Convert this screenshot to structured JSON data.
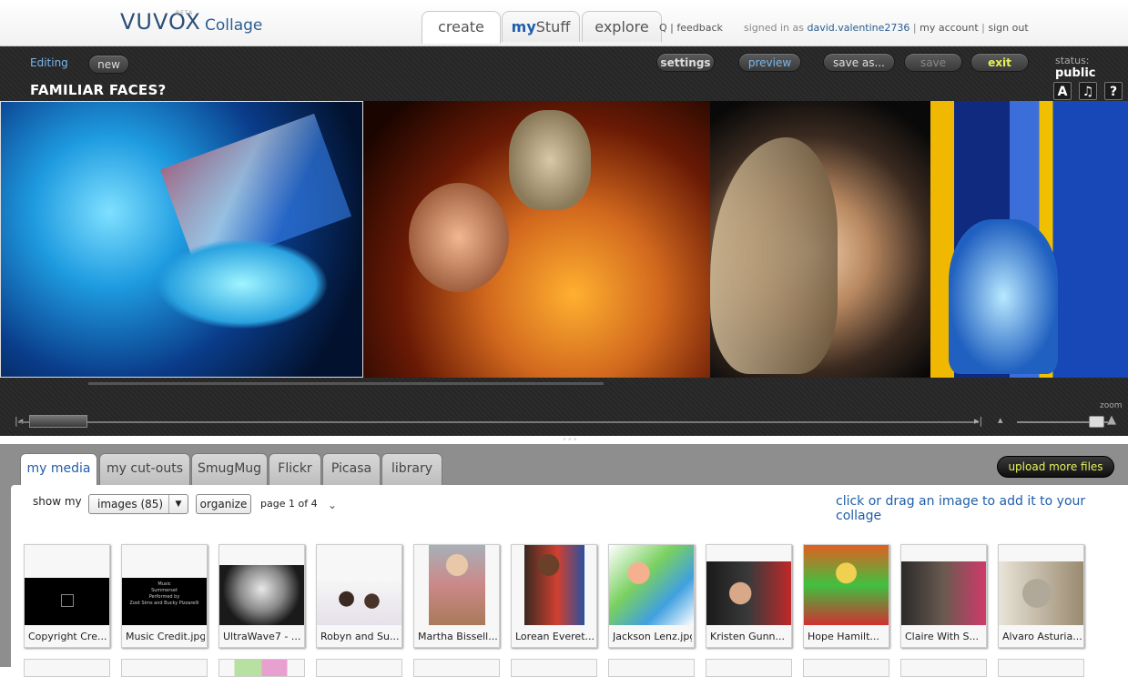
{
  "brand": {
    "logo_text": "VUVOX",
    "beta": "BETA",
    "product": "Collage"
  },
  "nav": {
    "tabs": [
      {
        "label": "create"
      },
      {
        "label_hl": "my",
        "label_rest": "Stuff"
      },
      {
        "label": "explore"
      }
    ]
  },
  "top_links": {
    "faq_tail": "Q",
    "sep": "|",
    "feedback": "feedback"
  },
  "account": {
    "signed_in_as": "signed in as",
    "username": "david.valentine2736",
    "sep": "|",
    "my_account": "my account",
    "sign_out": "sign out"
  },
  "toolbar": {
    "editing": "Editing",
    "new": "new",
    "settings": "settings",
    "preview": "preview",
    "save_as": "save as...",
    "save": "save",
    "exit": "exit",
    "status_label": "status:",
    "status_value": "public",
    "title": "FAMILIAR FACES?",
    "icons": {
      "text": "A",
      "music": "♫",
      "help": "?"
    }
  },
  "timeline": {
    "zoom_label": "zoom",
    "dots": "•••"
  },
  "media": {
    "tabs": [
      "my media",
      "my cut-outs",
      "SmugMug",
      "Flickr",
      "Picasa",
      "library"
    ],
    "active_tab": "my media",
    "upload_button": "upload more files",
    "show_my": "show my",
    "filter_value": "images (85)",
    "organize": "organize",
    "page_info": "page 1 of 4",
    "hint": "click or drag an image to add it to your collage",
    "thumbnails": [
      {
        "caption": "Copyright Cre..."
      },
      {
        "caption": "Music Credit.jpg"
      },
      {
        "caption": "UltraWave7 - ..."
      },
      {
        "caption": "Robyn and Su..."
      },
      {
        "caption": "Martha Bissell..."
      },
      {
        "caption": "Lorean Everet..."
      },
      {
        "caption": "Jackson Lenz.jpg"
      },
      {
        "caption": "Kristen Gunn..."
      },
      {
        "caption": "Hope Hamilt..."
      },
      {
        "caption": "Claire With S..."
      },
      {
        "caption": "Alvaro Asturia..."
      }
    ],
    "music_credit_lines": [
      "Music",
      "Summerset",
      "Performed by",
      "Zoot Sims and Bucky Pizzarelli"
    ]
  },
  "colors": {
    "accent": "#1f5ea8",
    "exit": "#e6f25a",
    "toolbar_bg": "#2a2a2a",
    "panel_bg": "#8e8e8e"
  }
}
